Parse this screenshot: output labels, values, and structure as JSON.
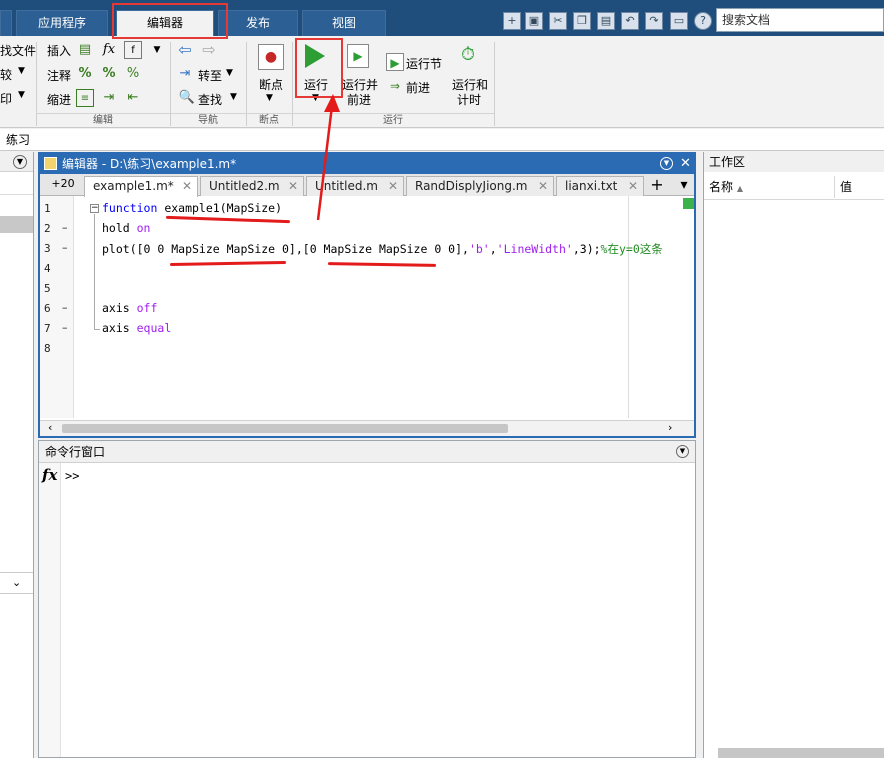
{
  "top_tabs": [
    "应用程序",
    "编辑器",
    "发布",
    "视图"
  ],
  "search": {
    "placeholder": "搜索文档"
  },
  "ribbon": {
    "file_partial": [
      "找文件",
      "较",
      "印"
    ],
    "edit": {
      "insert": "插入",
      "comment": "注释",
      "indent": "缩进",
      "group": "编辑"
    },
    "nav": {
      "goto": "转至",
      "find": "查找",
      "group": "导航"
    },
    "breakpoints": {
      "label": "断点",
      "group": "断点"
    },
    "run": {
      "run": "运行",
      "run_advance_1": "运行并",
      "run_advance_2": "前进",
      "run_section": "运行节",
      "advance": "前进",
      "run_time_1": "运行和",
      "run_time_2": "计时",
      "group": "运行"
    }
  },
  "path_bar": "练习",
  "editor": {
    "title": "编辑器 - D:\\练习\\example1.m*",
    "zoom": "+20",
    "tabs": [
      "example1.m*",
      "Untitled2.m",
      "Untitled.m",
      "RandDisplyJiong.m",
      "lianxi.txt"
    ],
    "lines": [
      "1",
      "2",
      "3",
      "4",
      "5",
      "6",
      "7",
      "8"
    ],
    "code": {
      "l1_kw": "function",
      "l1_rest": " example1(MapSize)",
      "l2_a": "hold ",
      "l2_b": "on",
      "l3_a": "plot([0 0 MapSize MapSize 0],[0 MapSize MapSize 0 0],",
      "l3_b": "'b'",
      "l3_c": ",",
      "l3_d": "'LineWidth'",
      "l3_e": ",3);",
      "l3_f": "%在y=0这条",
      "l6_a": "axis ",
      "l6_b": "off",
      "l7_a": "axis ",
      "l7_b": "equal"
    }
  },
  "command_window": {
    "title": "命令行窗口",
    "prompt": ">>",
    "fx": "fx"
  },
  "workspace": {
    "title": "工作区",
    "col_name": "名称",
    "col_value": "值"
  }
}
